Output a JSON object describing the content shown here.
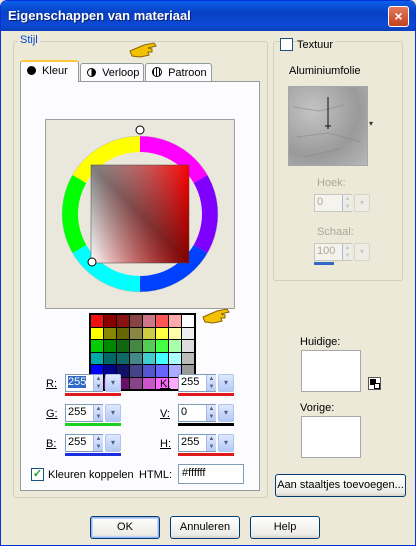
{
  "window": {
    "title": "Eigenschappen van materiaal",
    "close_glyph": "×"
  },
  "stijl": {
    "group_label": "Stijl",
    "tabs": [
      {
        "label": "Kleur",
        "icon": "solid-circle-icon"
      },
      {
        "label": "Verloop",
        "icon": "half-circle-icon"
      },
      {
        "label": "Patroon",
        "icon": "pattern-icon"
      }
    ],
    "swatches": [
      "#ee1111",
      "#880000",
      "#881111",
      "#884444",
      "#cc7788",
      "#ff5555",
      "#ffaaaa",
      "#ffffff",
      "#ffff00",
      "#888800",
      "#666600",
      "#888844",
      "#cccc44",
      "#ffff44",
      "#ffffaa",
      "#eeeeee",
      "#00cc00",
      "#008800",
      "#116611",
      "#448844",
      "#55cc55",
      "#44ff44",
      "#aaffaa",
      "#dddddd",
      "#00aaaa",
      "#006666",
      "#116666",
      "#448888",
      "#44cccc",
      "#44ffff",
      "#aaffff",
      "#bbbbbb",
      "#0000ff",
      "#000088",
      "#111166",
      "#444488",
      "#5555cc",
      "#6666ff",
      "#aaaaff",
      "#999999",
      "#ff00ff",
      "#880088",
      "#661166",
      "#884488",
      "#cc55cc",
      "#ff66ff",
      "#ffaaff",
      "#666666"
    ],
    "fields": {
      "R": {
        "label": "R:",
        "value": "255",
        "accent": "#e01a1a"
      },
      "G": {
        "label": "G:",
        "value": "255",
        "accent": "#1cd11c"
      },
      "B": {
        "label": "B:",
        "value": "255",
        "accent": "#1a2ee0"
      },
      "K": {
        "label": "K:",
        "value": "255",
        "accent": "#e01a1a"
      },
      "V": {
        "label": "V:",
        "value": "0",
        "accent": "#000000"
      },
      "H": {
        "label": "H:",
        "value": "255",
        "accent": "#e01a1a"
      }
    },
    "couple_label": "Kleuren koppelen",
    "couple_checked": true,
    "html_label": "HTML:",
    "html_value": "#ffffff"
  },
  "textuur": {
    "label": "Textuur",
    "checked": false,
    "texture_name": "Aluminiumfolie",
    "hoek_label": "Hoek:",
    "hoek_value": "0",
    "schaal_label": "Schaal:",
    "schaal_value": "100"
  },
  "preview": {
    "huidige_label": "Huidige:",
    "vorige_label": "Vorige:",
    "add_swatch_button": "Aan staaltjes toevoegen..."
  },
  "buttons": {
    "ok": "OK",
    "cancel": "Annuleren",
    "help": "Help"
  }
}
